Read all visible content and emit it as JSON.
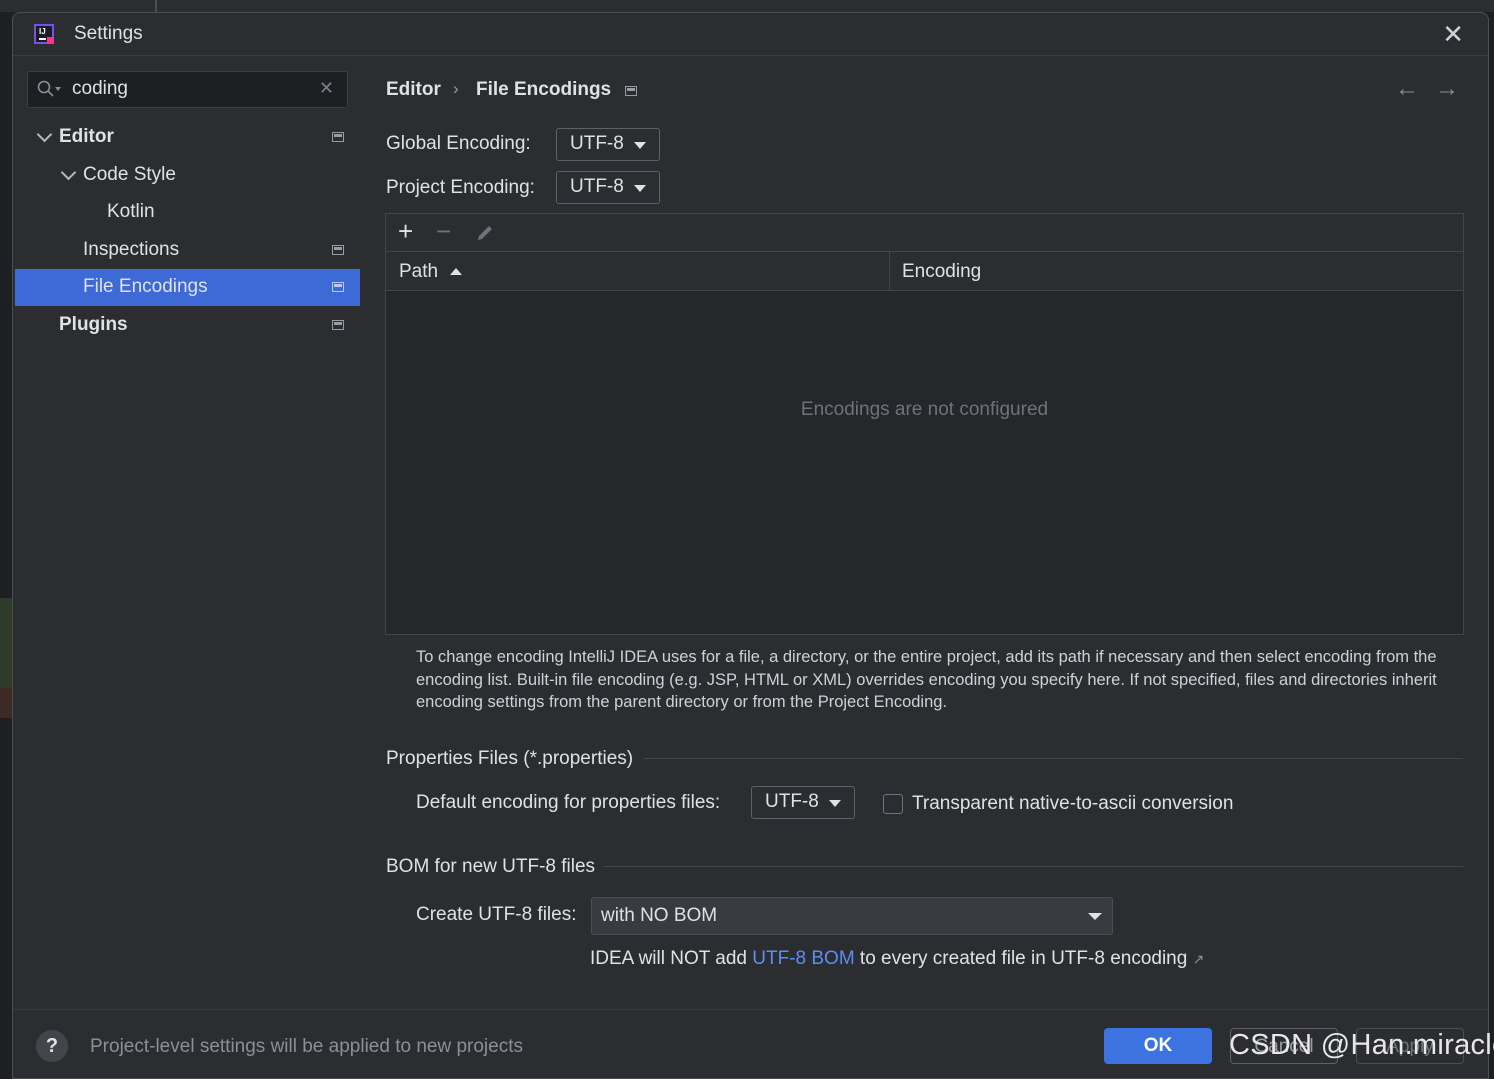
{
  "window": {
    "title": "Settings"
  },
  "sidebar": {
    "search_value": "coding",
    "items": [
      {
        "label": "Editor"
      },
      {
        "label": "Code Style"
      },
      {
        "label": "Kotlin"
      },
      {
        "label": "Inspections"
      },
      {
        "label": "File Encodings",
        "selected": true
      },
      {
        "label": "Plugins"
      }
    ]
  },
  "breadcrumb": {
    "parent": "Editor",
    "separator": "›",
    "current": "File Encodings"
  },
  "nav": {
    "back": "←",
    "forward": "→"
  },
  "encodings": {
    "global_label": "Global Encoding:",
    "global_value": "UTF-8",
    "project_label": "Project Encoding:",
    "project_value": "UTF-8"
  },
  "table": {
    "columns": [
      "Path",
      "Encoding"
    ],
    "sorted_column": "Path",
    "sort_direction": "ascending",
    "empty_text": "Encodings are not configured",
    "toolbar": {
      "add": "+",
      "remove": "−"
    }
  },
  "help_text": "To change encoding IntelliJ IDEA uses for a file, a directory, or the entire project, add its path if necessary and then select encoding from the encoding list. Built-in file encoding (e.g. JSP, HTML or XML) overrides encoding you specify here. If not specified, files and directories inherit encoding settings from the parent directory or from the Project Encoding.",
  "properties": {
    "section_title": "Properties Files (*.properties)",
    "default_label": "Default encoding for properties files:",
    "default_value": "UTF-8",
    "transparent_label": "Transparent native-to-ascii conversion",
    "transparent_checked": false
  },
  "bom": {
    "section_title": "BOM for new UTF-8 files",
    "create_label": "Create UTF-8 files:",
    "create_value": "with NO BOM",
    "info_prefix": "IDEA will NOT add ",
    "info_link": "UTF-8 BOM",
    "info_suffix": " to every created file in UTF-8 encoding",
    "info_ext": "↗"
  },
  "footer": {
    "help": "?",
    "note": "Project-level settings will be applied to new projects",
    "ok": "OK",
    "cancel": "Cancel",
    "apply": "Apply"
  },
  "watermark": "CSDN @Han.miracle",
  "colors": {
    "accent": "#3d73e0",
    "selection": "#3d6ad6",
    "link": "#5b8ff5",
    "background": "#2b2d30"
  }
}
